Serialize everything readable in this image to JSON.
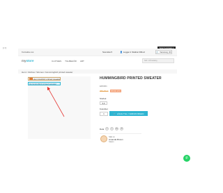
{
  "topbar": {
    "corner_brackets": "[<<]",
    "contact": "Kontakta oss",
    "language": "Svenska ▾",
    "login": "Logga in",
    "account": "Skafsa Vilbud",
    "cart": "Varukorg (0)",
    "lang_box": "Select Language ▾"
  },
  "header": {
    "logo_prefix": "my",
    "logo_main": "store",
    "nav": [
      "CLOTHES",
      "TILLBEHÖR",
      "ART"
    ],
    "search_placeholder": "Sök i vår katalog"
  },
  "breadcrumb": "Hem / Clothes / Women / Hummingbird printed sweater",
  "gallery": {
    "thumb_text": "Hummingbird printed sweater",
    "alt_text": "Hummingbird printed sweater"
  },
  "product": {
    "title": "HUMMINGBIRD PRINTED SWEATER",
    "subtitle": "ER9001",
    "old_price": "359,00 kr",
    "discount": "SPARA 20%",
    "size_label": "Storlek",
    "size_value": "S ▾",
    "quantity_label": "Kvantitet",
    "quantity_value": "1",
    "add_to_cart": "LÄGG TILL I VARUKORGEN",
    "share_label": "Dela",
    "share_icons": [
      "f",
      "t",
      "G+",
      "P"
    ]
  },
  "seller": {
    "label": "Säljs av",
    "name": "Amanda Brown",
    "status": "Säljare"
  },
  "colors": {
    "accent": "#2fb5d2",
    "price": "#e4a04b",
    "discount_bg": "#f39d72",
    "annotation_arrow": "#e53935",
    "whatsapp": "#25d366"
  }
}
